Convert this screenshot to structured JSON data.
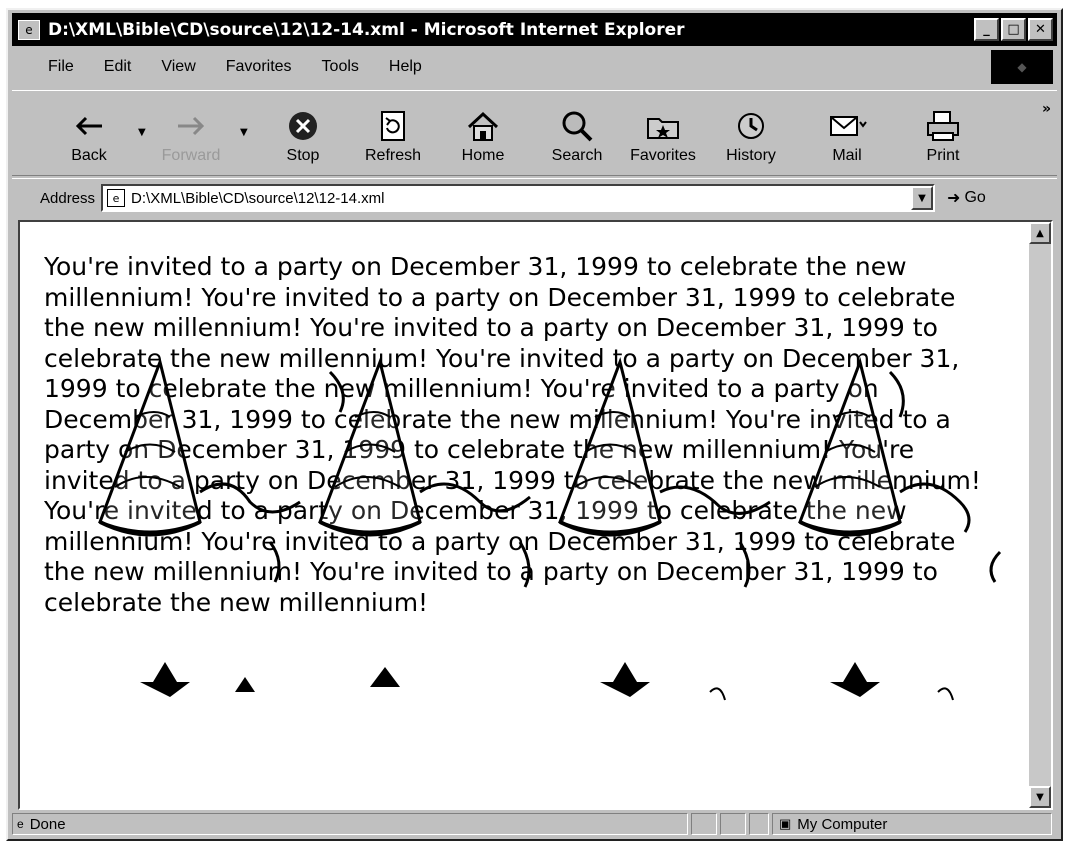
{
  "window": {
    "title": "D:\\XML\\Bible\\CD\\source\\12\\12-14.xml - Microsoft Internet Explorer"
  },
  "menu": [
    "File",
    "Edit",
    "View",
    "Favorites",
    "Tools",
    "Help"
  ],
  "toolbar": {
    "back": "Back",
    "forward": "Forward",
    "stop": "Stop",
    "refresh": "Refresh",
    "home": "Home",
    "search": "Search",
    "favorites": "Favorites",
    "history": "History",
    "mail": "Mail",
    "print": "Print"
  },
  "address": {
    "label": "Address",
    "value": "D:\\XML\\Bible\\CD\\source\\12\\12-14.xml",
    "go": "Go"
  },
  "content": {
    "text": "You're invited to a party on December 31, 1999 to celebrate the new millennium! You're invited to a party on December 31, 1999 to celebrate the new millennium! You're invited to a party on December 31, 1999 to celebrate the new millennium! You're invited to a party on December 31, 1999 to celebrate the new millennium! You're invited to a party on December 31, 1999 to celebrate the new millennium! You're invited to a party on December 31, 1999 to celebrate the new millennium! You're invited to a party on December 31, 1999 to celebrate the new millennium! You're invited to a party on December 31, 1999 to celebrate the new millennium! You're invited to a party on December 31, 1999 to celebrate the new millennium! You're invited to a party on December 31, 1999 to celebrate the new millennium!"
  },
  "status": {
    "left": "Done",
    "zone": "My Computer"
  }
}
